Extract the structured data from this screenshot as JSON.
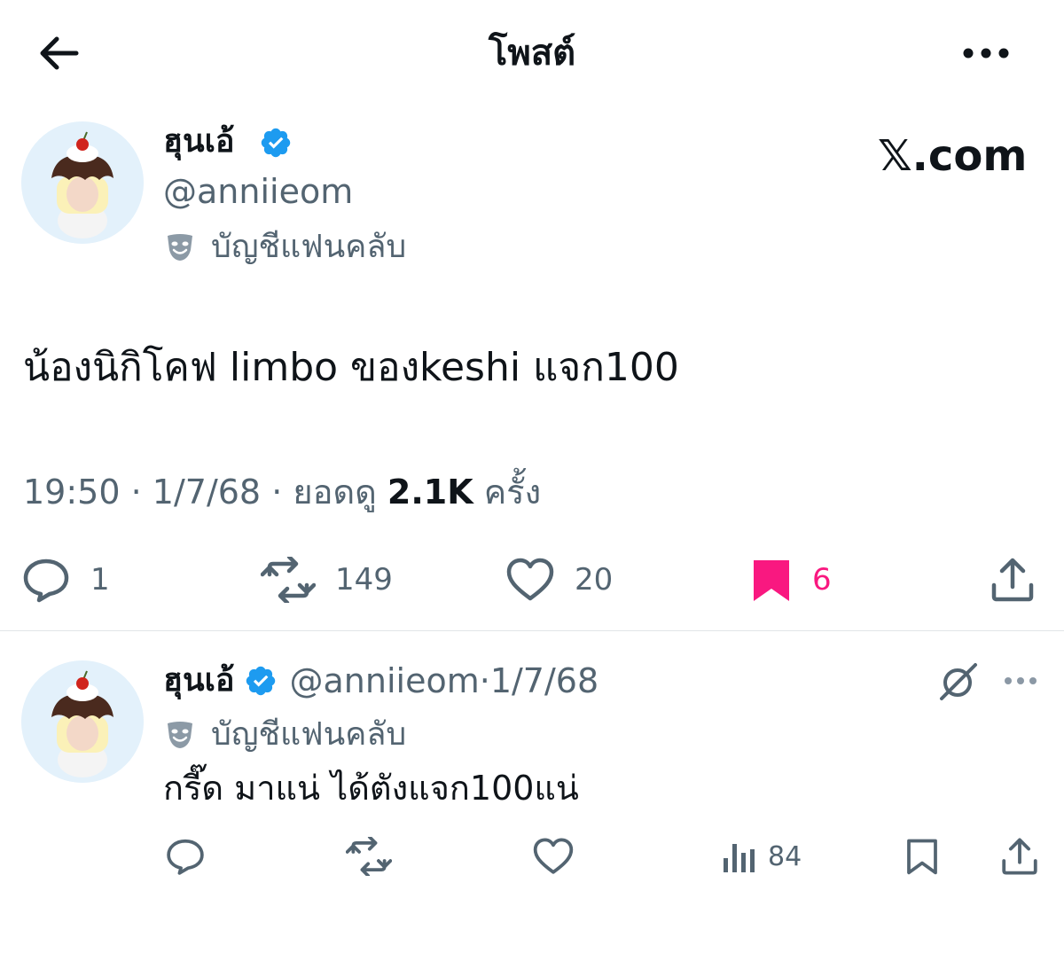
{
  "header": {
    "title": "โพสต์",
    "back_icon": "arrow-left-icon",
    "more_icon": "more-horizontal-icon"
  },
  "post": {
    "author_name": "ฮุนเอ้",
    "handle": "@anniieom",
    "badge_label": "บัญชีแฟนคลับ",
    "watermark": "𝕏.com",
    "text": "น้องนิกิโคฟ limbo ของkeshi แจก100",
    "time": "19:50",
    "date": "1/7/68",
    "views_prefix": "ยอดดู",
    "views_count": "2.1K",
    "views_suffix": "ครั้ง",
    "actions": {
      "reply": "1",
      "repost": "149",
      "like": "20",
      "bookmark": "6"
    },
    "colors": {
      "verified": "#1d9bf0",
      "bookmark_active": "#f91880",
      "muted": "#536471"
    }
  },
  "reply": {
    "author_name": "ฮุนเอ้",
    "handle": "@anniieom",
    "date": "1/7/68",
    "badge_label": "บัญชีแฟนคลับ",
    "text": "กรี๊ด มาแน่ ได้ตังแจก100แน่",
    "actions": {
      "views": "84"
    }
  }
}
